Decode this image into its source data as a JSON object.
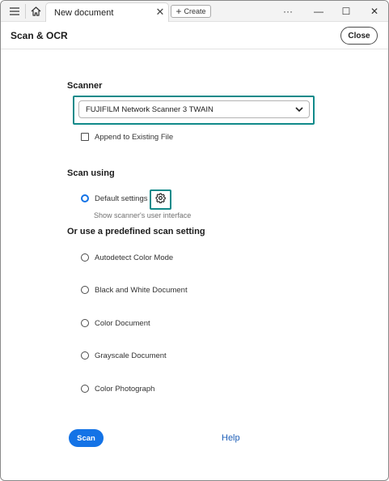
{
  "titlebar": {
    "menu_icon": "hamburger-icon",
    "home_icon": "home-icon",
    "tab_label": "New document",
    "tab_close_glyph": "✕",
    "create_label": "Create",
    "more_glyph": "···",
    "minimize_glyph": "—",
    "maximize_glyph": "☐",
    "close_glyph": "✕"
  },
  "header": {
    "title": "Scan & OCR",
    "close_label": "Close"
  },
  "scanner": {
    "section_title": "Scanner",
    "selected": "FUJIFILM Network Scanner 3 TWAIN",
    "append_label": "Append to Existing File",
    "append_checked": false
  },
  "scan_using": {
    "section_title": "Scan using",
    "default_label": "Default settings",
    "show_ui_label": "Show scanner's user interface"
  },
  "predefined": {
    "section_title": "Or use a predefined scan setting",
    "options": [
      {
        "label": "Autodetect Color Mode"
      },
      {
        "label": "Black and White Document"
      },
      {
        "label": "Color Document"
      },
      {
        "label": "Grayscale Document"
      },
      {
        "label": "Color Photograph"
      }
    ]
  },
  "footer": {
    "scan_label": "Scan",
    "help_label": "Help"
  },
  "colors": {
    "accent": "#1473e6",
    "focus_ring": "#118a8a",
    "link": "#1e5fb8"
  }
}
